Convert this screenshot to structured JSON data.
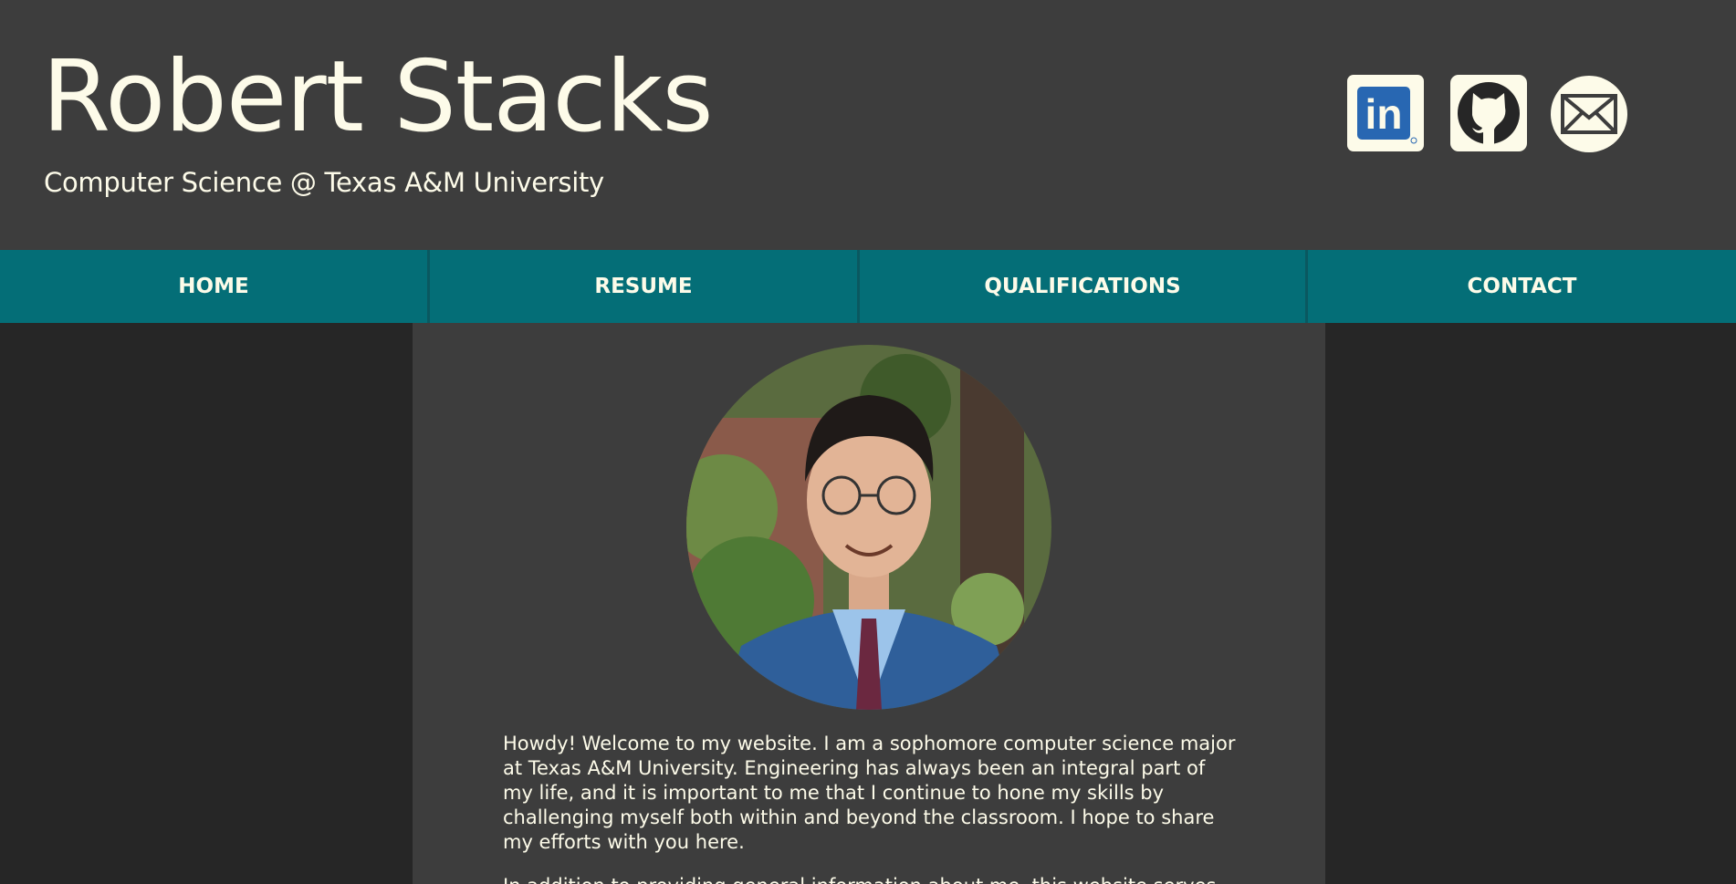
{
  "header": {
    "name": "Robert Stacks",
    "tagline": "Computer Science @ Texas A&M University",
    "social": [
      {
        "icon": "linkedin-icon",
        "label": "in"
      },
      {
        "icon": "github-icon"
      },
      {
        "icon": "envelope-icon"
      }
    ]
  },
  "nav": {
    "items": [
      "HOME",
      "RESUME",
      "QUALIFICATIONS",
      "CONTACT"
    ]
  },
  "main": {
    "photo": {
      "description_icon": "profile-photo"
    },
    "paragraphs": [
      "Howdy! Welcome to my website. I am a sophomore computer science major at Texas A&M University. Engineering has always been an integral part of my life, and it is important to me that I continue to hone my skills by challenging myself both within and beyond the classroom. I hope to share my efforts with you here.",
      "In addition to providing general information about me, this website serves as a"
    ]
  },
  "colors": {
    "page_background": "#262626",
    "header_background": "#3d3d3d",
    "nav_background": "#046e77",
    "text": "#fdfbe9",
    "linkedin_blue": "#2867b2"
  }
}
